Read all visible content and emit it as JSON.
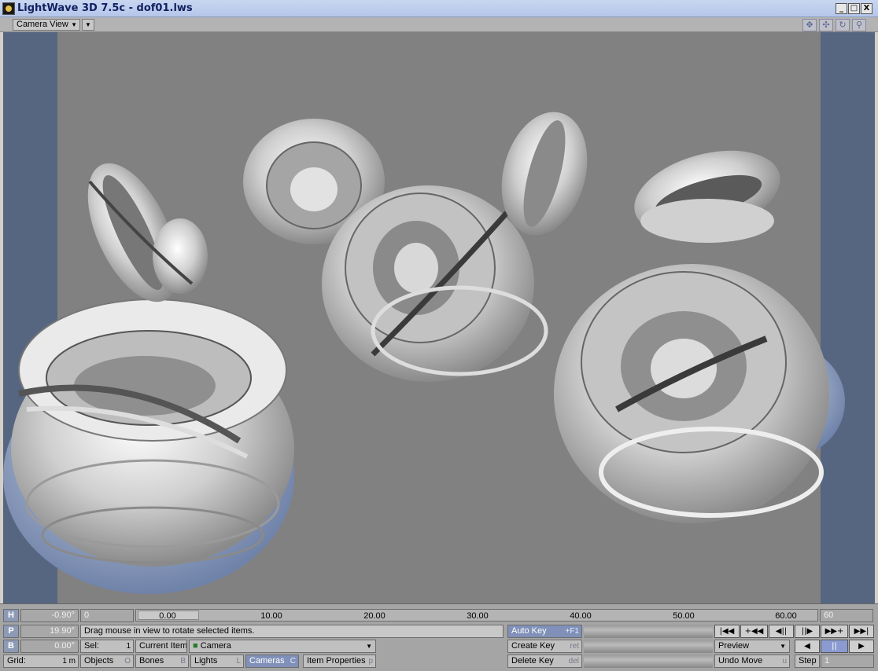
{
  "window": {
    "title": "LightWave 3D 7.5c - dof01.lws",
    "controls": [
      "_",
      "□",
      "X"
    ]
  },
  "viewbar": {
    "view_mode": "Camera View",
    "icons": [
      "move-view-icon",
      "rotate-view-icon",
      "orbit-view-icon",
      "zoom-view-icon"
    ]
  },
  "viewport": {
    "safe_area_color": "#566680",
    "background_color": "#818181",
    "objects": [
      "torus-sculpture",
      "torus-sculpture",
      "torus-sculpture",
      "torus-sculpture",
      "torus-sculpture",
      "torus-sculpture",
      "torus-sculpture"
    ]
  },
  "bottom": {
    "h_label": "H",
    "h_value": "-0.90°",
    "p_label": "P",
    "p_value": "19.90°",
    "b_label": "B",
    "b_value": "0.00°",
    "grid_label": "Grid:",
    "grid_value": "1 m",
    "frame_start": "0",
    "frame_end": "60",
    "timeline_ticks": [
      "0.00",
      "10.00",
      "20.00",
      "30.00",
      "40.00",
      "50.00",
      "60.00"
    ],
    "status": "Drag mouse in view to rotate selected items.",
    "sel_label": "Sel:",
    "sel_value": "1",
    "current_item_label": "Current Item",
    "current_item": "Camera",
    "tabs": [
      {
        "label": "Objects",
        "key": "O"
      },
      {
        "label": "Bones",
        "key": "B"
      },
      {
        "label": "Lights",
        "key": "L"
      },
      {
        "label": "Cameras",
        "key": "C"
      }
    ],
    "item_properties": {
      "label": "Item Properties",
      "key": "p"
    },
    "auto_key": {
      "label": "Auto Key",
      "key": "+F1"
    },
    "create_key": {
      "label": "Create Key",
      "key": "ret"
    },
    "delete_key": {
      "label": "Delete Key",
      "key": "del"
    },
    "transport_row1": [
      "|◀◀",
      "+◀◀",
      "◀||",
      "||▶",
      "▶▶+",
      "▶▶|"
    ],
    "preview": "Preview",
    "transport_row2": [
      "◀",
      "||",
      "▶"
    ],
    "undo_move": {
      "label": "Undo Move",
      "key": "u"
    },
    "step_label": "Step",
    "step_value": "1"
  }
}
